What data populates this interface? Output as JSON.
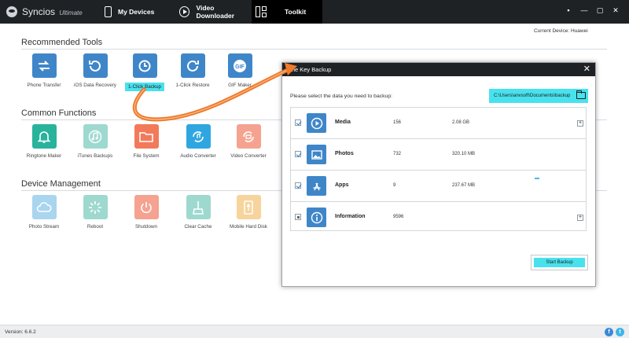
{
  "titlebar": {
    "app_name": "Syncios",
    "edition": "Ultimate",
    "tabs": [
      {
        "label": "My Devices"
      },
      {
        "label": "Video Downloader"
      },
      {
        "label": "Toolkit"
      }
    ],
    "window_buttons": {
      "menu": "▪",
      "minimize": "—",
      "maximize": "▢",
      "close": "✕"
    }
  },
  "current_device": "Current Device: Huawei",
  "sections": {
    "recommended": {
      "title": "Recommended Tools",
      "tools": [
        {
          "label": "Phone Transfer",
          "icon": "transfer-arrows-icon"
        },
        {
          "label": "iOS Data Recovery",
          "icon": "recovery-icon"
        },
        {
          "label": "1-Click Backup",
          "icon": "backup-clock-icon"
        },
        {
          "label": "1-Click Restore",
          "icon": "restore-icon"
        },
        {
          "label": "GIF Maker",
          "icon": "gif-icon"
        }
      ]
    },
    "common": {
      "title": "Common Functions",
      "tools": [
        {
          "label": "Ringtone Maker",
          "icon": "bell-icon"
        },
        {
          "label": "iTunes Backups",
          "icon": "music-note-icon"
        },
        {
          "label": "File System",
          "icon": "folder-icon"
        },
        {
          "label": "Audio Converter",
          "icon": "audio-convert-icon"
        },
        {
          "label": "Video Converter",
          "icon": "video-convert-icon"
        }
      ]
    },
    "device": {
      "title": "Device Management",
      "tools": [
        {
          "label": "Photo Stream",
          "icon": "cloud-icon"
        },
        {
          "label": "Reboot",
          "icon": "reboot-icon"
        },
        {
          "label": "Shutdown",
          "icon": "power-icon"
        },
        {
          "label": "Clear Cache",
          "icon": "broom-icon"
        },
        {
          "label": "Mobile Hard Disk",
          "icon": "usb-icon"
        }
      ]
    }
  },
  "modal": {
    "title": "One Key Backup",
    "close": "✕",
    "prompt": "Please select the data you need to backup:",
    "path": "C:\\Users\\anvsoft\\Documents\\backup",
    "rows": [
      {
        "name": "Media",
        "count": "156",
        "size": "2.08 GB",
        "checked": true,
        "expand": "+"
      },
      {
        "name": "Photos",
        "count": "732",
        "size": "320.10 MB",
        "checked": true,
        "expand": ""
      },
      {
        "name": "Apps",
        "count": "9",
        "size": "237.67 MB",
        "checked": true,
        "expand": ""
      },
      {
        "name": "Information",
        "count": "9596",
        "size": "",
        "checked": false,
        "expand": "+"
      }
    ],
    "start_button": "Start Backup"
  },
  "footer": {
    "version": "Version: 6.6.2",
    "facebook": "f",
    "twitter": "t"
  },
  "colors": {
    "titlebar": "#1e2225",
    "highlight": "#48e2ee",
    "arrow": "#f07a28",
    "blue": "#3f86c9"
  }
}
